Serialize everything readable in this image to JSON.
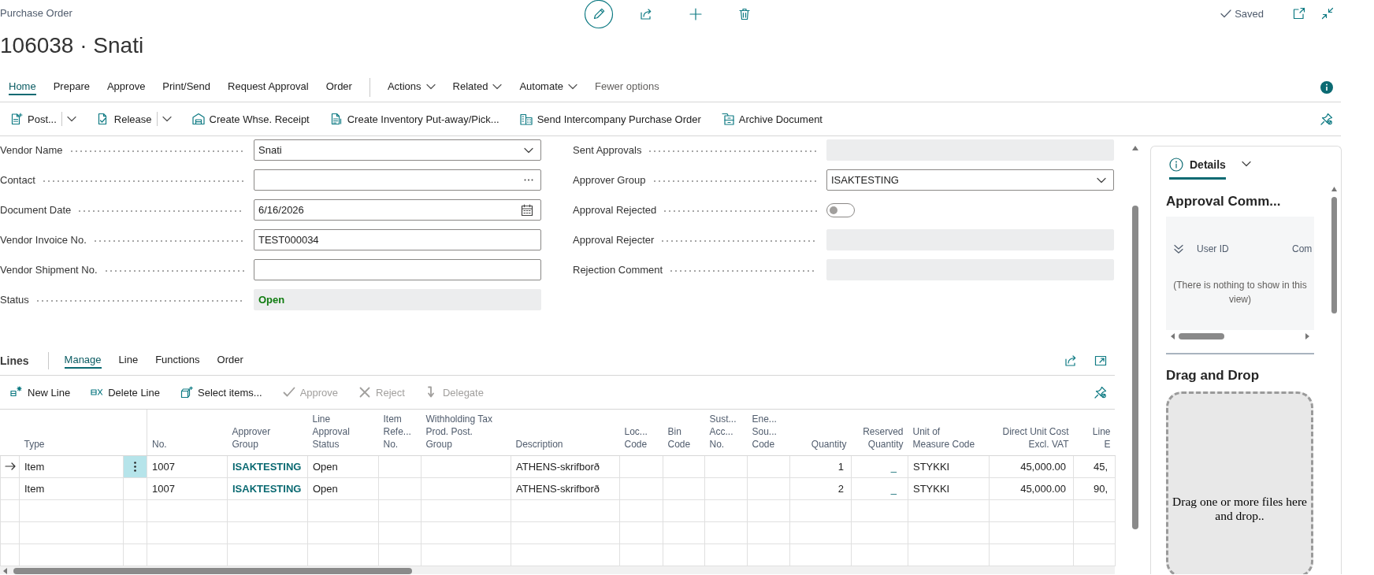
{
  "header": {
    "caption": "Purchase Order",
    "title": "106038 · Snati",
    "saved": "Saved"
  },
  "tabs": [
    {
      "label": "Home",
      "selected": true
    },
    {
      "label": "Prepare",
      "selected": false
    },
    {
      "label": "Approve",
      "selected": false
    },
    {
      "label": "Print/Send",
      "selected": false
    },
    {
      "label": "Request Approval",
      "selected": false
    },
    {
      "label": "Order",
      "selected": false
    }
  ],
  "menus": [
    "Actions",
    "Related",
    "Automate"
  ],
  "fewer_options": "Fewer options",
  "actions": [
    {
      "label": "Post...",
      "split": true
    },
    {
      "label": "Release",
      "split": true
    },
    {
      "label": "Create Whse. Receipt",
      "split": false
    },
    {
      "label": "Create Inventory Put-away/Pick...",
      "split": false
    },
    {
      "label": "Send Intercompany Purchase Order",
      "split": false
    },
    {
      "label": "Archive Document",
      "split": false
    }
  ],
  "form": {
    "left": [
      {
        "label": "Vendor Name",
        "kind": "lookup",
        "value": "Snati"
      },
      {
        "label": "Contact",
        "kind": "assist"
      },
      {
        "label": "Document Date",
        "kind": "date",
        "value": "6/16/2026"
      },
      {
        "label": "Vendor Invoice No.",
        "kind": "text",
        "value": "TEST000034"
      },
      {
        "label": "Vendor Shipment No.",
        "kind": "text"
      },
      {
        "label": "Status",
        "kind": "status",
        "value": "Open"
      }
    ],
    "right": [
      {
        "label": "Sent Approvals",
        "kind": "readonly"
      },
      {
        "label": "Approver Group",
        "kind": "lookup",
        "value": "ISAKTESTING"
      },
      {
        "label": "Approval Rejected",
        "kind": "toggle",
        "on": false
      },
      {
        "label": "Approval Rejecter",
        "kind": "readonly"
      },
      {
        "label": "Rejection Comment",
        "kind": "readonly"
      }
    ]
  },
  "lines": {
    "title": "Lines",
    "tabs": [
      {
        "label": "Manage",
        "selected": true
      },
      {
        "label": "Line",
        "selected": false
      },
      {
        "label": "Functions",
        "selected": false
      },
      {
        "label": "Order",
        "selected": false
      }
    ],
    "actions": [
      {
        "label": "New Line",
        "disabled": false
      },
      {
        "label": "Delete Line",
        "disabled": false
      },
      {
        "label": "Select items...",
        "disabled": false
      },
      {
        "label": "Approve",
        "disabled": true
      },
      {
        "label": "Reject",
        "disabled": true
      },
      {
        "label": "Delegate",
        "disabled": true
      }
    ],
    "table": {
      "columns": [
        {
          "label": "Type",
          "kind": "text"
        },
        {
          "label": "No.",
          "kind": "text"
        },
        {
          "label": "Approver\nGroup",
          "kind": "strong"
        },
        {
          "label": "Line\nApproval\nStatus",
          "kind": "text"
        },
        {
          "label": "Item\nRefe...\nNo.",
          "kind": "text"
        },
        {
          "label": "Withholding Tax\nProd. Post.\nGroup",
          "kind": "text"
        },
        {
          "label": "Description",
          "kind": "text"
        },
        {
          "label": "Loc...\nCode",
          "kind": "text"
        },
        {
          "label": "Bin\nCode",
          "kind": "text"
        },
        {
          "label": "Sust...\nAcc...\nNo.",
          "kind": "text"
        },
        {
          "label": "Ene...\nSou...\nCode",
          "kind": "text"
        },
        {
          "label": "Quantity",
          "kind": "number"
        },
        {
          "label": "Reserved\nQuantity",
          "kind": "drilldown"
        },
        {
          "label": "Unit of\nMeasure Code",
          "kind": "text"
        },
        {
          "label": "Direct Unit Cost\nExcl. VAT",
          "kind": "number"
        },
        {
          "label": "Line\nE",
          "kind": "number"
        }
      ],
      "rows": [
        {
          "selected": true,
          "cells": [
            "Item",
            "1007",
            "ISAKTESTING",
            "Open",
            null,
            null,
            "ATHENS-skrifborð",
            null,
            null,
            null,
            null,
            "1",
            "_",
            "STYKKI",
            "45,000.00",
            "45,"
          ]
        },
        {
          "selected": false,
          "cells": [
            "Item",
            "1007",
            "ISAKTESTING",
            "Open",
            null,
            null,
            "ATHENS-skrifborð",
            null,
            null,
            null,
            null,
            "2",
            "_",
            "STYKKI",
            "45,000.00",
            "90,"
          ]
        }
      ]
    }
  },
  "factbox": {
    "tabs": [
      {
        "label": "Details",
        "selected": true
      }
    ],
    "approval_comments": {
      "title": "Approval Comm...",
      "columns": [
        "User ID",
        "Com"
      ],
      "empty_text": "(There is nothing to show in this view)"
    },
    "drag_and_drop": {
      "title": "Drag and Drop",
      "hint": "Drag one or more files here and drop.."
    }
  }
}
